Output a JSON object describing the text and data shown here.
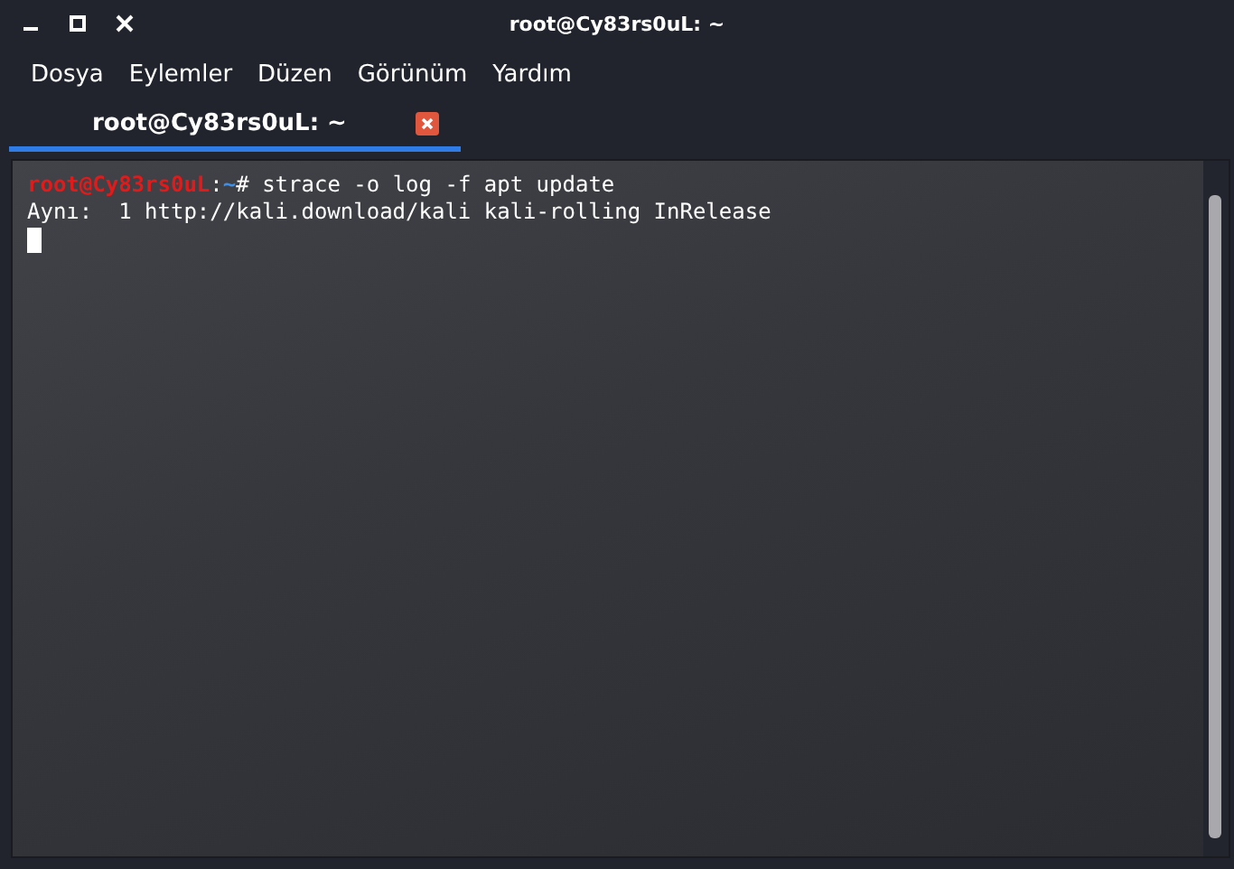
{
  "window": {
    "title": "root@Cy83rs0uL: ~"
  },
  "menu": [
    "Dosya",
    "Eylemler",
    "Düzen",
    "Görünüm",
    "Yardım"
  ],
  "tabs": [
    {
      "label": "root@Cy83rs0uL: ~",
      "selected": true
    }
  ],
  "terminal": {
    "lines": [
      {
        "segments": [
          {
            "text": "root@Cy83rs0uL",
            "kind": "user"
          },
          {
            "text": ":",
            "kind": "plain"
          },
          {
            "text": "~",
            "kind": "path"
          },
          {
            "text": "# strace -o log -f apt update",
            "kind": "plain"
          }
        ]
      },
      {
        "segments": [
          {
            "text": "Aynı:  1 http://kali.download/kali kali-rolling InRelease",
            "kind": "plain"
          }
        ]
      }
    ],
    "cursor": true
  }
}
